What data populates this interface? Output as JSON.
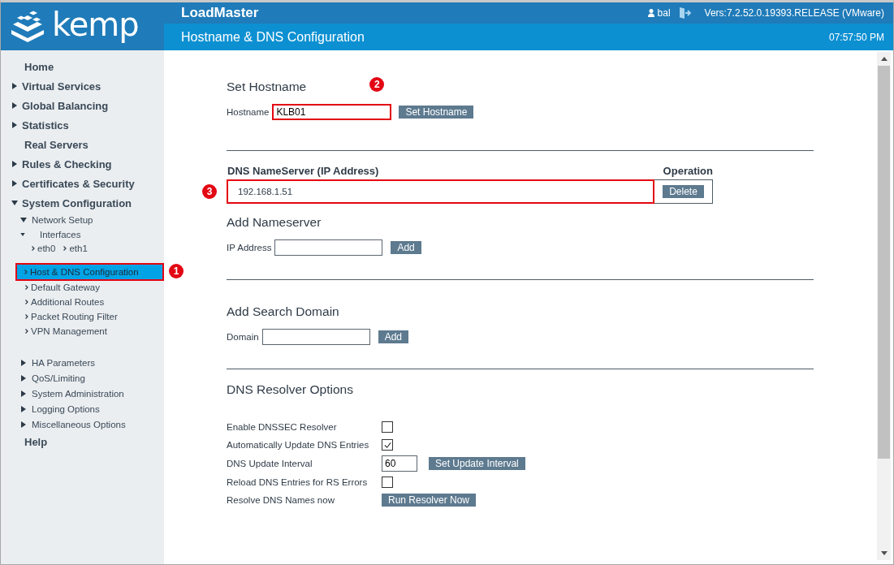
{
  "header": {
    "logo": "kemp",
    "product": "LoadMaster",
    "user": "bal",
    "version": "Vers:7.2.52.0.19393.RELEASE (VMware)",
    "page_title": "Hostname & DNS Configuration",
    "time": "07:57:50 PM"
  },
  "sidebar": {
    "items": [
      {
        "label": "Home",
        "kind": "section"
      },
      {
        "label": "Virtual Services",
        "kind": "section",
        "expanded": false
      },
      {
        "label": "Global Balancing",
        "kind": "section",
        "expanded": false
      },
      {
        "label": "Statistics",
        "kind": "section",
        "expanded": false
      },
      {
        "label": "Real Servers",
        "kind": "section"
      },
      {
        "label": "Rules & Checking",
        "kind": "section",
        "expanded": false
      },
      {
        "label": "Certificates & Security",
        "kind": "section",
        "expanded": false
      },
      {
        "label": "System Configuration",
        "kind": "section",
        "expanded": true,
        "children": [
          {
            "label": "Network Setup",
            "kind": "group",
            "expanded": true,
            "children": [
              {
                "label": "Interfaces",
                "kind": "group",
                "expanded": true,
                "children": [
                  {
                    "label": "eth0",
                    "kind": "link",
                    "selected": false
                  },
                  {
                    "label": "eth1",
                    "kind": "link",
                    "selected": false
                  }
                ]
              },
              {
                "label": "Host & DNS Configuration",
                "kind": "link",
                "selected": true,
                "highlighted": true,
                "callout": "1"
              },
              {
                "label": "Default Gateway",
                "kind": "link",
                "selected": false
              },
              {
                "label": "Additional Routes",
                "kind": "link",
                "selected": false
              },
              {
                "label": "Packet Routing Filter",
                "kind": "link",
                "selected": false
              },
              {
                "label": "VPN Management",
                "kind": "link",
                "selected": false
              }
            ]
          },
          {
            "label": "HA Parameters",
            "kind": "group",
            "expanded": false
          },
          {
            "label": "QoS/Limiting",
            "kind": "group",
            "expanded": false
          },
          {
            "label": "System Administration",
            "kind": "group",
            "expanded": false
          },
          {
            "label": "Logging Options",
            "kind": "group",
            "expanded": false
          },
          {
            "label": "Miscellaneous Options",
            "kind": "group",
            "expanded": false
          }
        ]
      },
      {
        "label": "Help",
        "kind": "section"
      }
    ]
  },
  "hostname": {
    "title": "Set Hostname",
    "label": "Hostname",
    "value": "KLB01",
    "button": "Set Hostname",
    "highlighted": true,
    "callout": "2"
  },
  "nameservers": {
    "columns": [
      "DNS NameServer (IP Address)",
      "Operation"
    ],
    "rows": [
      {
        "address": "192.168.1.51",
        "button": "Delete",
        "highlighted": true,
        "callout": "3"
      }
    ]
  },
  "add_nameserver": {
    "title": "Add Nameserver",
    "label": "IP Address",
    "button": "Add"
  },
  "search_domain": {
    "title": "Add Search Domain",
    "label": "Domain",
    "button": "Add"
  },
  "resolver": {
    "title": "DNS Resolver Options",
    "options": [
      {
        "kind": "checkbox",
        "label": "Enable DNSSEC Resolver",
        "checked": false
      },
      {
        "kind": "checkbox",
        "label": "Automatically Update DNS Entries",
        "checked": true
      },
      {
        "kind": "input",
        "label": "DNS Update Interval",
        "value": "60",
        "button": "Set Update Interval"
      },
      {
        "kind": "checkbox",
        "label": "Reload DNS Entries for RS Errors",
        "checked": false
      },
      {
        "kind": "button",
        "label": "Resolve DNS Names now",
        "button": "Run Resolver Now"
      }
    ]
  }
}
